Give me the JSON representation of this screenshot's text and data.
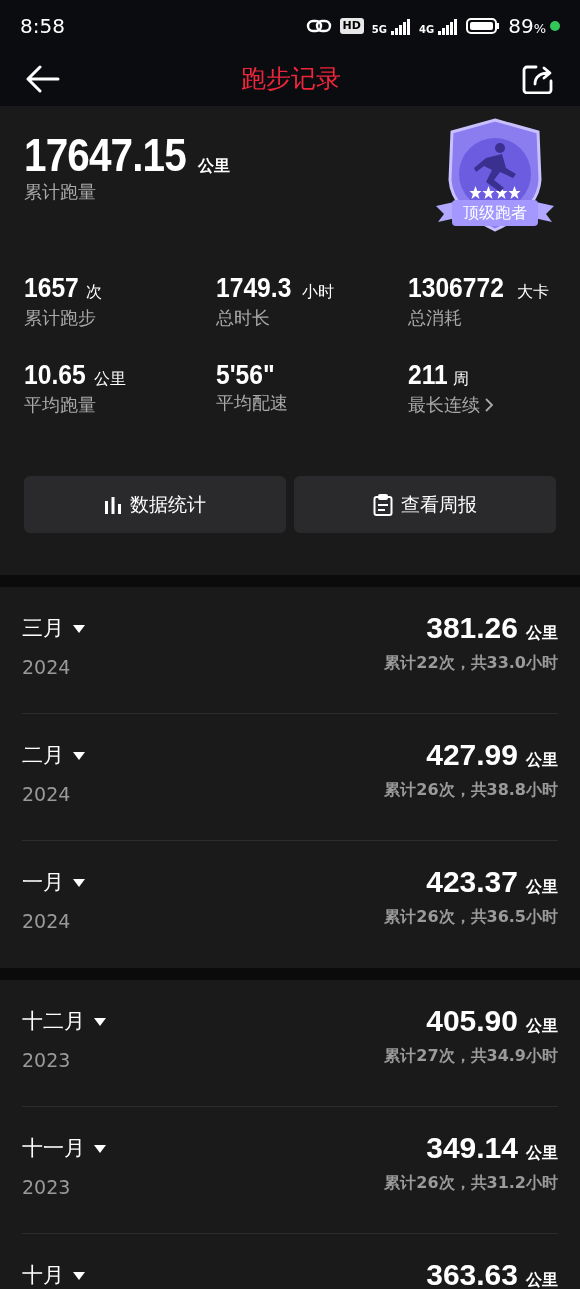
{
  "status_bar": {
    "time": "8:58",
    "hd": "HD",
    "signals": [
      {
        "label": "5G"
      },
      {
        "label": "4G"
      }
    ],
    "battery": "89",
    "percent": "%"
  },
  "header": {
    "title": "跑步记录"
  },
  "summary": {
    "total": {
      "value": "17647.15",
      "unit": "公里",
      "label": "累计跑量"
    },
    "badge": {
      "text": "顶级跑者"
    },
    "stats": [
      {
        "value": "1657",
        "unit": "次",
        "label": "累计跑步",
        "chevron": false
      },
      {
        "value": "1749.3",
        "unit": "小时",
        "label": "总时长",
        "chevron": false
      },
      {
        "value": "1306772",
        "unit": "大卡",
        "label": "总消耗",
        "chevron": false
      },
      {
        "value": "10.65",
        "unit": "公里",
        "label": "平均跑量",
        "chevron": false
      },
      {
        "value": "5'56\"",
        "label": "平均配速",
        "chevron": false
      },
      {
        "value": "211",
        "unit": "周",
        "label": "最长连续",
        "chevron": true
      }
    ],
    "buttons": [
      {
        "kind": "stats",
        "label": "数据统计"
      },
      {
        "kind": "report",
        "label": "查看周报"
      }
    ]
  },
  "groups": [
    {
      "months": [
        {
          "month": "三月",
          "year": "2024",
          "distance": "381.26",
          "unit": "公里",
          "summary": "累计22次，共33.0小时"
        },
        {
          "month": "二月",
          "year": "2024",
          "distance": "427.99",
          "unit": "公里",
          "summary": "累计26次，共38.8小时"
        },
        {
          "month": "一月",
          "year": "2024",
          "distance": "423.37",
          "unit": "公里",
          "summary": "累计26次，共36.5小时"
        }
      ]
    },
    {
      "months": [
        {
          "month": "十二月",
          "year": "2023",
          "distance": "405.90",
          "unit": "公里",
          "summary": "累计27次，共34.9小时"
        },
        {
          "month": "十一月",
          "year": "2023",
          "distance": "349.14",
          "unit": "公里",
          "summary": "累计26次，共31.2小时"
        },
        {
          "month": "十月",
          "distance": "363.63",
          "unit": "公里"
        }
      ]
    }
  ]
}
